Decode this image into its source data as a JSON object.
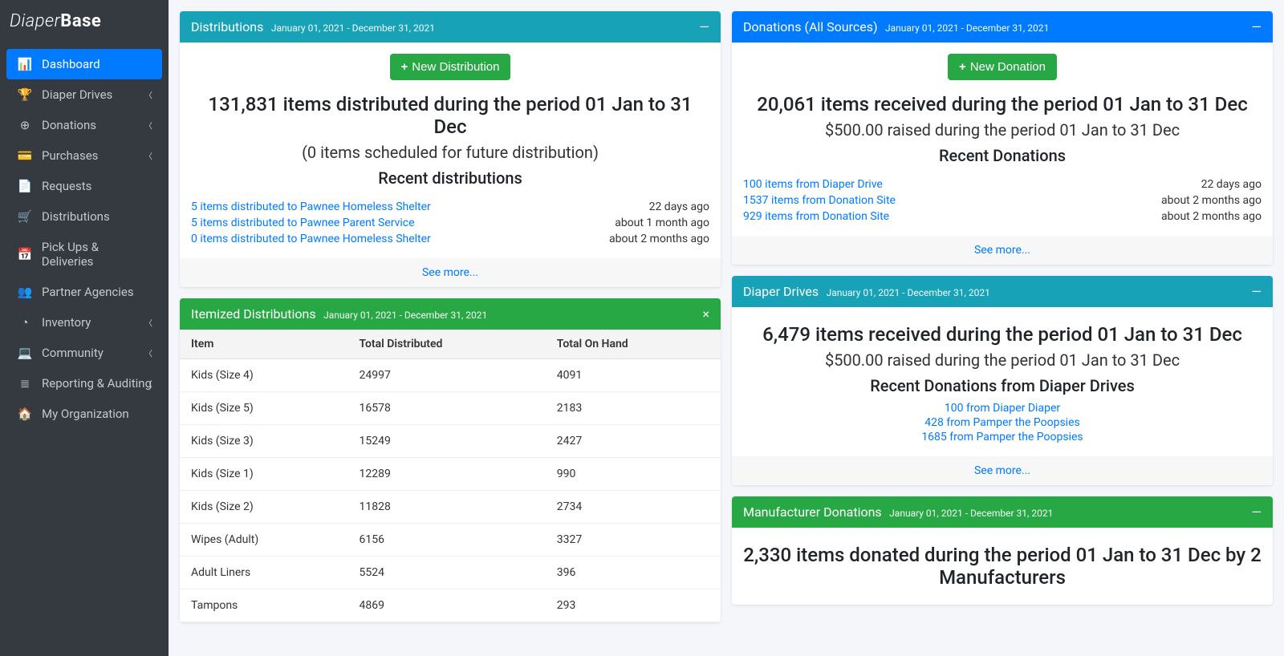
{
  "brand": {
    "part1": "Diaper",
    "part2": "Base"
  },
  "sidebar": [
    {
      "icon": "📊",
      "label": "Dashboard",
      "active": true,
      "expandable": false
    },
    {
      "icon": "🏆",
      "label": "Diaper Drives",
      "active": false,
      "expandable": true
    },
    {
      "icon": "⊕",
      "label": "Donations",
      "active": false,
      "expandable": true
    },
    {
      "icon": "💳",
      "label": "Purchases",
      "active": false,
      "expandable": true
    },
    {
      "icon": "📄",
      "label": "Requests",
      "active": false,
      "expandable": false
    },
    {
      "icon": "🛒",
      "label": "Distributions",
      "active": false,
      "expandable": false
    },
    {
      "icon": "📅",
      "label": "Pick Ups & Deliveries",
      "active": false,
      "expandable": false
    },
    {
      "icon": "👥",
      "label": "Partner Agencies",
      "active": false,
      "expandable": false
    },
    {
      "icon": "◔",
      "label": "Inventory",
      "active": false,
      "expandable": true
    },
    {
      "icon": "💻",
      "label": "Community",
      "active": false,
      "expandable": true
    },
    {
      "icon": "≣",
      "label": "Reporting & Auditing",
      "active": false,
      "expandable": true
    },
    {
      "icon": "🏠",
      "label": "My Organization",
      "active": false,
      "expandable": false
    }
  ],
  "dateRange": "January 01, 2021 - December 31, 2021",
  "distributions": {
    "title": "Distributions",
    "newBtn": "New Distribution",
    "headline": "131,831 items distributed during the period 01 Jan to 31 Dec",
    "sub": "(0 items scheduled for future distribution)",
    "recentTitle": "Recent distributions",
    "items": [
      {
        "text": "5 items distributed to Pawnee Homeless Shelter",
        "time": "22 days ago"
      },
      {
        "text": "5 items distributed to Pawnee Parent Service",
        "time": "about 1 month ago"
      },
      {
        "text": "0 items distributed to Pawnee Homeless Shelter",
        "time": "about 2 months ago"
      }
    ],
    "seeMore": "See more..."
  },
  "donations": {
    "title": "Donations (All Sources)",
    "newBtn": "New Donation",
    "headline": "20,061 items received during the period 01 Jan to 31 Dec",
    "sub": "$500.00 raised during the period 01 Jan to 31 Dec",
    "recentTitle": "Recent Donations",
    "items": [
      {
        "text": "100 items from Diaper Drive",
        "time": "22 days ago"
      },
      {
        "text": "1537 items from Donation Site",
        "time": "about 2 months ago"
      },
      {
        "text": "929 items from Donation Site",
        "time": "about 2 months ago"
      }
    ],
    "seeMore": "See more..."
  },
  "itemized": {
    "title": "Itemized Distributions",
    "cols": [
      "Item",
      "Total Distributed",
      "Total On Hand"
    ],
    "rows": [
      [
        "Kids (Size 4)",
        "24997",
        "4091"
      ],
      [
        "Kids (Size 5)",
        "16578",
        "2183"
      ],
      [
        "Kids (Size 3)",
        "15249",
        "2427"
      ],
      [
        "Kids (Size 1)",
        "12289",
        "990"
      ],
      [
        "Kids (Size 2)",
        "11828",
        "2734"
      ],
      [
        "Wipes (Adult)",
        "6156",
        "3327"
      ],
      [
        "Adult Liners",
        "5524",
        "396"
      ],
      [
        "Tampons",
        "4869",
        "293"
      ]
    ]
  },
  "drives": {
    "title": "Diaper Drives",
    "headline": "6,479 items received during the period 01 Jan to 31 Dec",
    "sub": "$500.00 raised during the period 01 Jan to 31 Dec",
    "recentTitle": "Recent Donations from Diaper Drives",
    "items": [
      "100 from Diaper Diaper",
      "428 from Pamper the Poopsies",
      "1685 from Pamper the Poopsies"
    ],
    "seeMore": "See more..."
  },
  "manufacturer": {
    "title": "Manufacturer Donations",
    "headline": "2,330 items donated during the period 01 Jan to 31 Dec by 2 Manufacturers"
  }
}
